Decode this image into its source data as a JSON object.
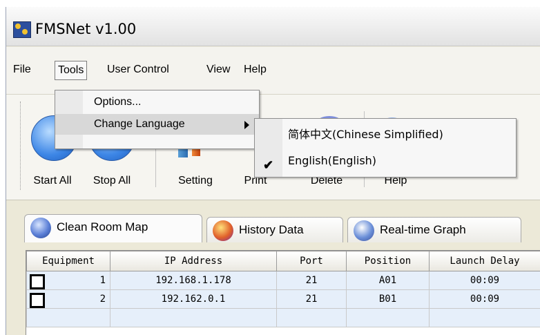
{
  "window": {
    "title": "FMSNet v1.00"
  },
  "menu": {
    "file": "File",
    "tools": "Tools",
    "user_control": "User Control",
    "view": "View",
    "help": "Help"
  },
  "tools_menu": {
    "options": "Options...",
    "change_language": "Change Language"
  },
  "language_menu": {
    "chinese": "简体中文(Chinese Simplified)",
    "english": "English(English)",
    "english_checked": true
  },
  "toolbar": {
    "start_all": "Start All",
    "stop_all": "Stop All",
    "setting": "Setting",
    "print": "Print",
    "delete": "Delete",
    "help": "Help"
  },
  "tabs": [
    {
      "label": "Clean Room Map",
      "icon": "clean-room-icon"
    },
    {
      "label": "History Data",
      "icon": "history-icon"
    },
    {
      "label": "Real-time Graph",
      "icon": "graph-icon"
    }
  ],
  "table": {
    "columns": [
      "Equipment",
      "IP Address",
      "Port",
      "Position",
      "Launch Delay"
    ],
    "rows": [
      {
        "equipment": "1",
        "ip": "192.168.1.178",
        "port": "21",
        "position": "A01",
        "delay": "00:09",
        "checked": false
      },
      {
        "equipment": "2",
        "ip": "192.162.0.1",
        "port": "21",
        "position": "B01",
        "delay": "00:09",
        "checked": false
      }
    ]
  },
  "colors": {
    "accent": "#3d86e6",
    "row_bg": "#e6effa"
  }
}
